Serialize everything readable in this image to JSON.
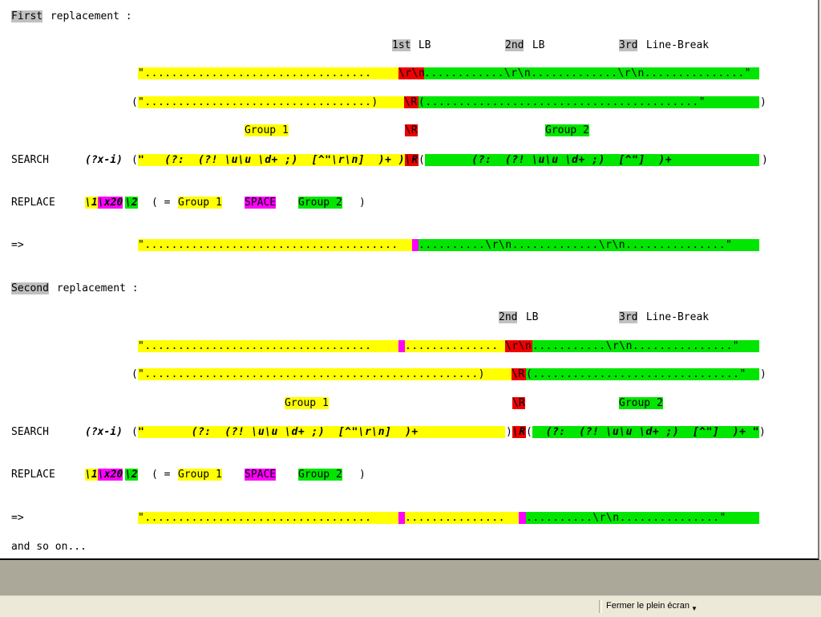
{
  "section1": {
    "title_highlight": "First",
    "title_rest": " replacement :",
    "lb1_key": "1st",
    "lb1_rest": " LB",
    "lb2_key": "2nd",
    "lb2_rest": " LB",
    "lb3_key": "3rd",
    "lb3_rest": " Line-Break",
    "line1_yellow": "\"..................................",
    "line1_red": "\\r\\n",
    "line1_green": "............\\r\\n.............\\r\\n...............\"",
    "line2_open": "(",
    "line2_yellow": "\"..................................)",
    "line2_red": "\\R",
    "line2_green": "(.........................................\"",
    "line2_close": ")",
    "group1": "Group 1",
    "group_r": "\\R",
    "group2": "Group 2",
    "search_label": "SEARCH",
    "search_mod": "(?x-i)",
    "search_open": "(",
    "search_yellow": "\"   (?:  (?! \\u\\u \\d+ ;)  [^\"\\r\\n]  )+ )",
    "search_red": "\\R",
    "search_green_open": "(",
    "search_green": "       (?:  (?! \\u\\u \\d+ ;)  [^\"]  )+              \"",
    "search_close": ")",
    "replace_label": "REPLACE",
    "replace_y1": "\\1",
    "replace_m": "\\x20",
    "replace_g2": "\\2",
    "replace_eq": "( =",
    "replace_group1": "Group 1",
    "replace_space": "SPACE",
    "replace_group2": "Group 2",
    "replace_close": ")",
    "result_label": "=>",
    "result_yellow": "\"......................................",
    "result_green": "..........\\r\\n.............\\r\\n...............\""
  },
  "section2": {
    "title_highlight": "Second",
    "title_rest": " replacement :",
    "lb2_key": "2nd",
    "lb2_rest": " LB",
    "lb3_key": "3rd",
    "lb3_rest": " Line-Break",
    "line1_yellow_a": "\"..................................",
    "line1_yellow_b": "..............",
    "line1_red": "\\r\\n",
    "line1_green": "...........\\r\\n...............\"",
    "line2_open": "(",
    "line2_yellow": "\"..................................................)",
    "line2_red": "\\R",
    "line2_green": "(...............................\"",
    "line2_close": ")",
    "group1": "Group 1",
    "group_r": "\\R",
    "group2": "Group 2",
    "search_label": "SEARCH",
    "search_mod": "(?x-i)",
    "search_open": "(",
    "search_yellow": "\"       (?:  (?! \\u\\u \\d+ ;)  [^\"\\r\\n]  )+",
    "search_paren": ")",
    "search_red": "\\R",
    "search_green_open": "(",
    "search_green": "  (?:  (?! \\u\\u \\d+ ;)  [^\"]  )+ \"",
    "search_close": ")",
    "replace_label": "REPLACE",
    "replace_y1": "\\1",
    "replace_m": "\\x20",
    "replace_g2": "\\2",
    "replace_eq": "( =",
    "replace_group1": "Group 1",
    "replace_space": "SPACE",
    "replace_group2": "Group 2",
    "replace_close": ")",
    "result_label": "=>",
    "result_yellow_a": "\"..................................",
    "result_yellow_b": "...............",
    "result_green": "..........\\r\\n...............\""
  },
  "footer_text": "and so on...",
  "status_bar": {
    "fullscreen_label": "Fermer le plein écran",
    "dropdown_icon": "chevron-down-icon"
  },
  "colors": {
    "group1": "#ffff00",
    "group2": "#00e600",
    "linebreak": "#ee0000",
    "space": "#ff00ff",
    "label": "#c0c0c0"
  }
}
